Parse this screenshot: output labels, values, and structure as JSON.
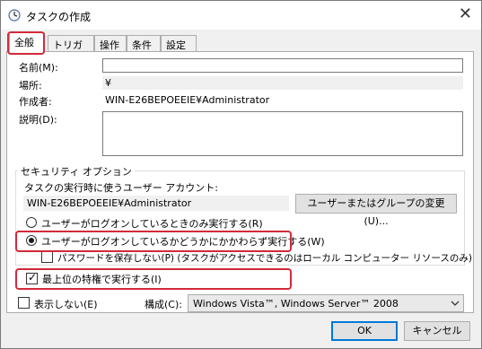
{
  "window": {
    "title": "タスクの作成",
    "close_glyph": "✕"
  },
  "tabs": [
    {
      "label": "全般",
      "active": true
    },
    {
      "label": "トリガー",
      "active": false
    },
    {
      "label": "操作",
      "active": false
    },
    {
      "label": "条件",
      "active": false
    },
    {
      "label": "設定",
      "active": false
    }
  ],
  "general": {
    "name_label": "名前(M):",
    "name_value": "",
    "location_label": "場所:",
    "location_value": "¥",
    "author_label": "作成者:",
    "author_value": "WIN-E26BEPOEEIE¥Administrator",
    "description_label": "説明(D):",
    "description_value": ""
  },
  "security": {
    "group_title": "セキュリティ オプション",
    "account_label": "タスクの実行時に使うユーザー アカウント:",
    "account_value": "WIN-E26BEPOEEIE¥Administrator",
    "change_button": "ユーザーまたはグループの変更(U)...",
    "radio_logged_on": "ユーザーがログオンしているときのみ実行する(R)",
    "radio_whether": "ユーザーがログオンしているかどうかにかかわらず実行する(W)",
    "no_store_password": "パスワードを保存しない(P) (タスクがアクセスできるのはローカル コンピューター リソースのみ)",
    "highest_privileges": "最上位の特権で実行する(I)",
    "selected_radio": "whether",
    "highest_checked": true,
    "no_store_checked": false
  },
  "footer_options": {
    "hidden_label": "表示しない(E)",
    "hidden_checked": false,
    "configure_label": "構成(C):",
    "configure_value": "Windows Vista™, Windows Server™ 2008"
  },
  "buttons": {
    "ok": "OK",
    "cancel": "キャンセル"
  },
  "colors": {
    "highlight": "#d4293a",
    "accent": "#0078d7"
  },
  "icons": {
    "title": "clock-icon",
    "dropdown": "chevron-down-icon"
  }
}
